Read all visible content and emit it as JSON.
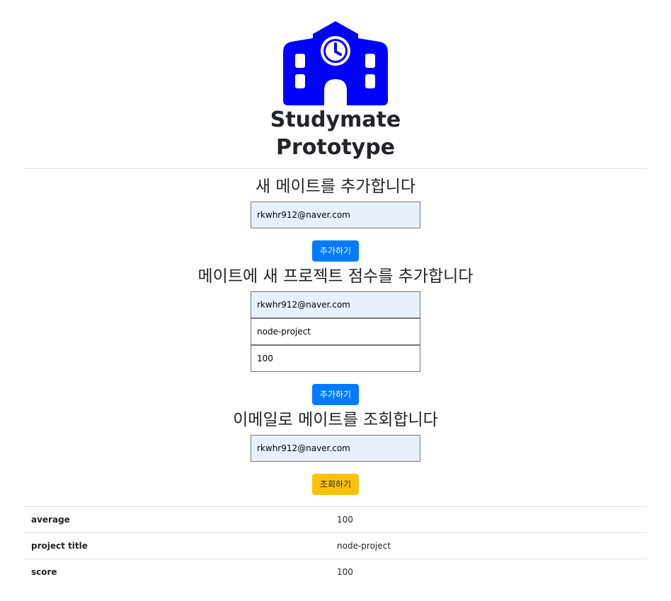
{
  "app": {
    "title_line1": "Studymate",
    "title_line2": "Prototype",
    "logo_icon": "school-building-clock-icon",
    "logo_color": "#0000ff"
  },
  "add_mate": {
    "heading": "새 메이트를 추가합니다",
    "email_value": "rkwhr912@naver.com",
    "button_label": "추가하기"
  },
  "add_score": {
    "heading": "메이트에 새 프로젝트 점수를 추가합니다",
    "email_value": "rkwhr912@naver.com",
    "project_value": "node-project",
    "score_value": "100",
    "button_label": "추가하기"
  },
  "lookup": {
    "heading": "이메일로 메이트를 조회합니다",
    "email_value": "rkwhr912@naver.com",
    "button_label": "조회하기"
  },
  "results": {
    "rows": [
      {
        "key": "average",
        "value": "100"
      },
      {
        "key": "project title",
        "value": "node-project"
      },
      {
        "key": "score",
        "value": "100"
      }
    ]
  },
  "colors": {
    "primary": "#007bff",
    "warning": "#ffc107",
    "autofill": "#e8f0fe"
  }
}
